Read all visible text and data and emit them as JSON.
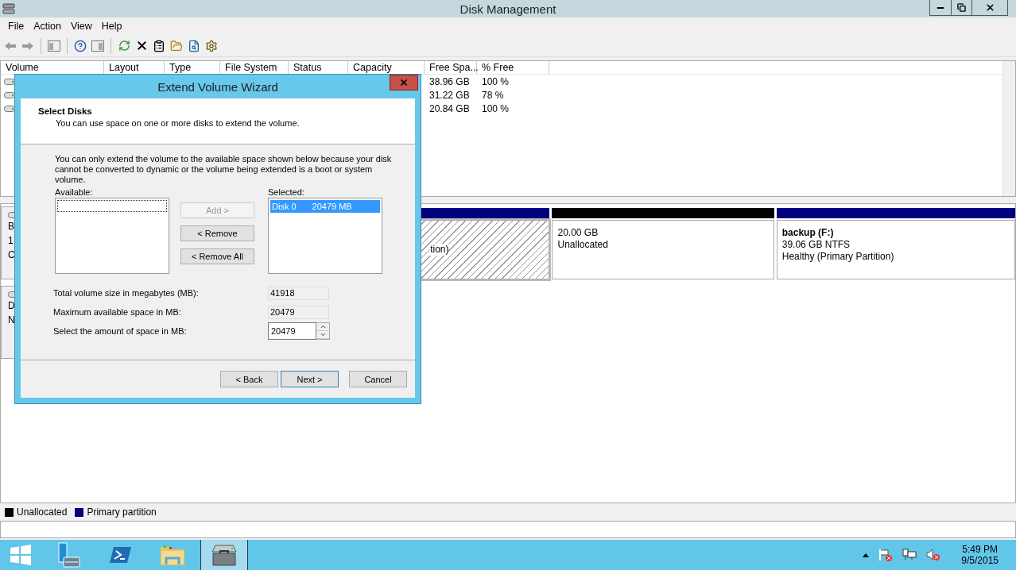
{
  "window": {
    "title": "Disk Management"
  },
  "menu": [
    {
      "label": "File"
    },
    {
      "label": "Action"
    },
    {
      "label": "View"
    },
    {
      "label": "Help"
    }
  ],
  "volume_list": {
    "columns": [
      "Volume",
      "Layout",
      "Type",
      "File System",
      "Status",
      "Capacity",
      "Free Spa...",
      "% Free"
    ],
    "rows": [
      {
        "free_space": "38.96 GB",
        "percent_free": "100 %"
      },
      {
        "free_space": "31.22 GB",
        "percent_free": "78 %"
      },
      {
        "free_space": "20.84 GB",
        "percent_free": "100 %"
      }
    ]
  },
  "disks": [
    {
      "label_lines": [
        "B",
        "1",
        "C"
      ],
      "partitions": [
        {
          "color": "#000080",
          "selected": true,
          "lines": [
            "tion)"
          ]
        },
        {
          "color": "#000000",
          "selected": false,
          "lines": [
            "20.00 GB",
            "Unallocated"
          ]
        },
        {
          "color": "#000080",
          "selected": false,
          "name": "backup  (F:)",
          "lines": [
            "39.06 GB NTFS",
            "Healthy (Primary Partition)"
          ]
        }
      ]
    },
    {
      "label_lines": [
        "D",
        "N"
      ]
    }
  ],
  "legend": [
    {
      "label": "Unallocated",
      "color": "#000000"
    },
    {
      "label": "Primary partition",
      "color": "#000080"
    }
  ],
  "wizard": {
    "title": "Extend Volume Wizard",
    "heading": "Select Disks",
    "subheading": "You can use space on one or more disks to extend the volume.",
    "note": "You can only extend the volume to the available space shown below because your disk cannot be converted to dynamic or the volume being extended is a boot or system volume.",
    "available_label": "Available:",
    "selected_label": "Selected:",
    "selected_items": [
      {
        "disk": "Disk 0",
        "size": "20479 MB",
        "selected": true
      }
    ],
    "move_buttons": [
      {
        "label": "Add >",
        "disabled": true
      },
      {
        "label": "< Remove",
        "disabled": false
      },
      {
        "label": "< Remove All",
        "disabled": false
      }
    ],
    "fields": [
      {
        "kind": "readonly",
        "label": "Total volume size in megabytes (MB):",
        "value": "41918"
      },
      {
        "kind": "readonly",
        "label": "Maximum available space in MB:",
        "value": "20479"
      },
      {
        "kind": "spinner",
        "label": "Select the amount of space in MB:",
        "value": "20479"
      }
    ],
    "nav_buttons": [
      {
        "label": "< Back",
        "default": false
      },
      {
        "label": "Next >",
        "default": true
      },
      {
        "label": "Cancel",
        "default": false
      }
    ]
  },
  "taskbar": {
    "apps": [
      {
        "kind": "server",
        "selected": false
      },
      {
        "kind": "powershell",
        "selected": false
      },
      {
        "kind": "explorer",
        "selected": false
      },
      {
        "kind": "disk",
        "selected": true
      }
    ],
    "clock": {
      "time": "5:49 PM",
      "date": "9/5/2015"
    }
  }
}
